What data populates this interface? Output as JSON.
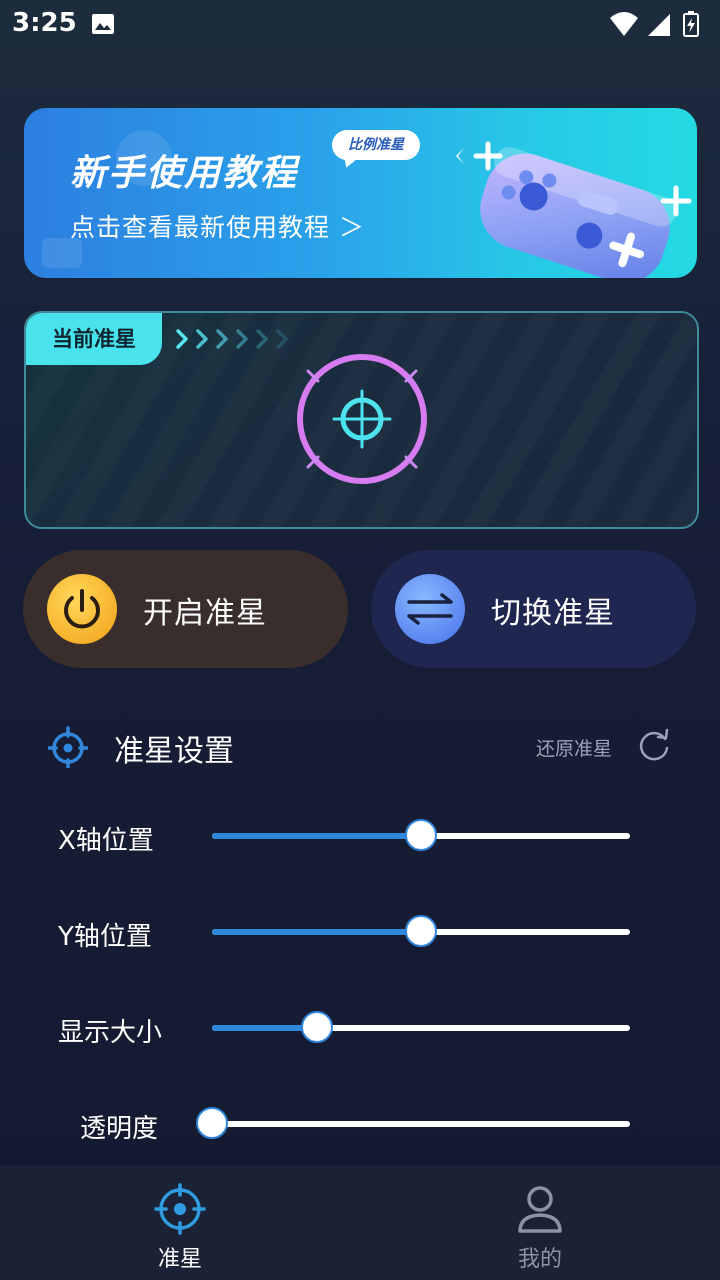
{
  "status_bar": {
    "time": "3:25",
    "icons": [
      "image-icon",
      "wifi-icon",
      "signal-icon",
      "battery-charging-icon"
    ]
  },
  "banner": {
    "title": "新手使用教程",
    "subtitle": "点击查看最新使用教程 ＞",
    "tag": "比例准星",
    "art": "gamepad-illustration"
  },
  "current_crosshair": {
    "label": "当前准星",
    "accent": "#48e3ec",
    "ring_color": "#d77cf0"
  },
  "actions": {
    "start_label": "开启准星",
    "start_icon": "power-icon",
    "switch_label": "切换准星",
    "switch_icon": "swap-arrows-icon"
  },
  "settings": {
    "title": "准星设置",
    "reset_label": "还原准星",
    "sliders": [
      {
        "label": "X轴位置",
        "value": 0.5
      },
      {
        "label": "Y轴位置",
        "value": 0.5
      },
      {
        "label": "显示大小",
        "value": 0.25
      },
      {
        "label": "透明度",
        "value": 0.0
      }
    ]
  },
  "nav": {
    "items": [
      {
        "label": "准星",
        "icon": "crosshair-icon",
        "active": true
      },
      {
        "label": "我的",
        "icon": "person-icon",
        "active": false
      }
    ]
  },
  "colors": {
    "primary_blue": "#2f86db",
    "start_button_bg": "#3a2e2d",
    "switch_button_bg": "#1f2650"
  }
}
